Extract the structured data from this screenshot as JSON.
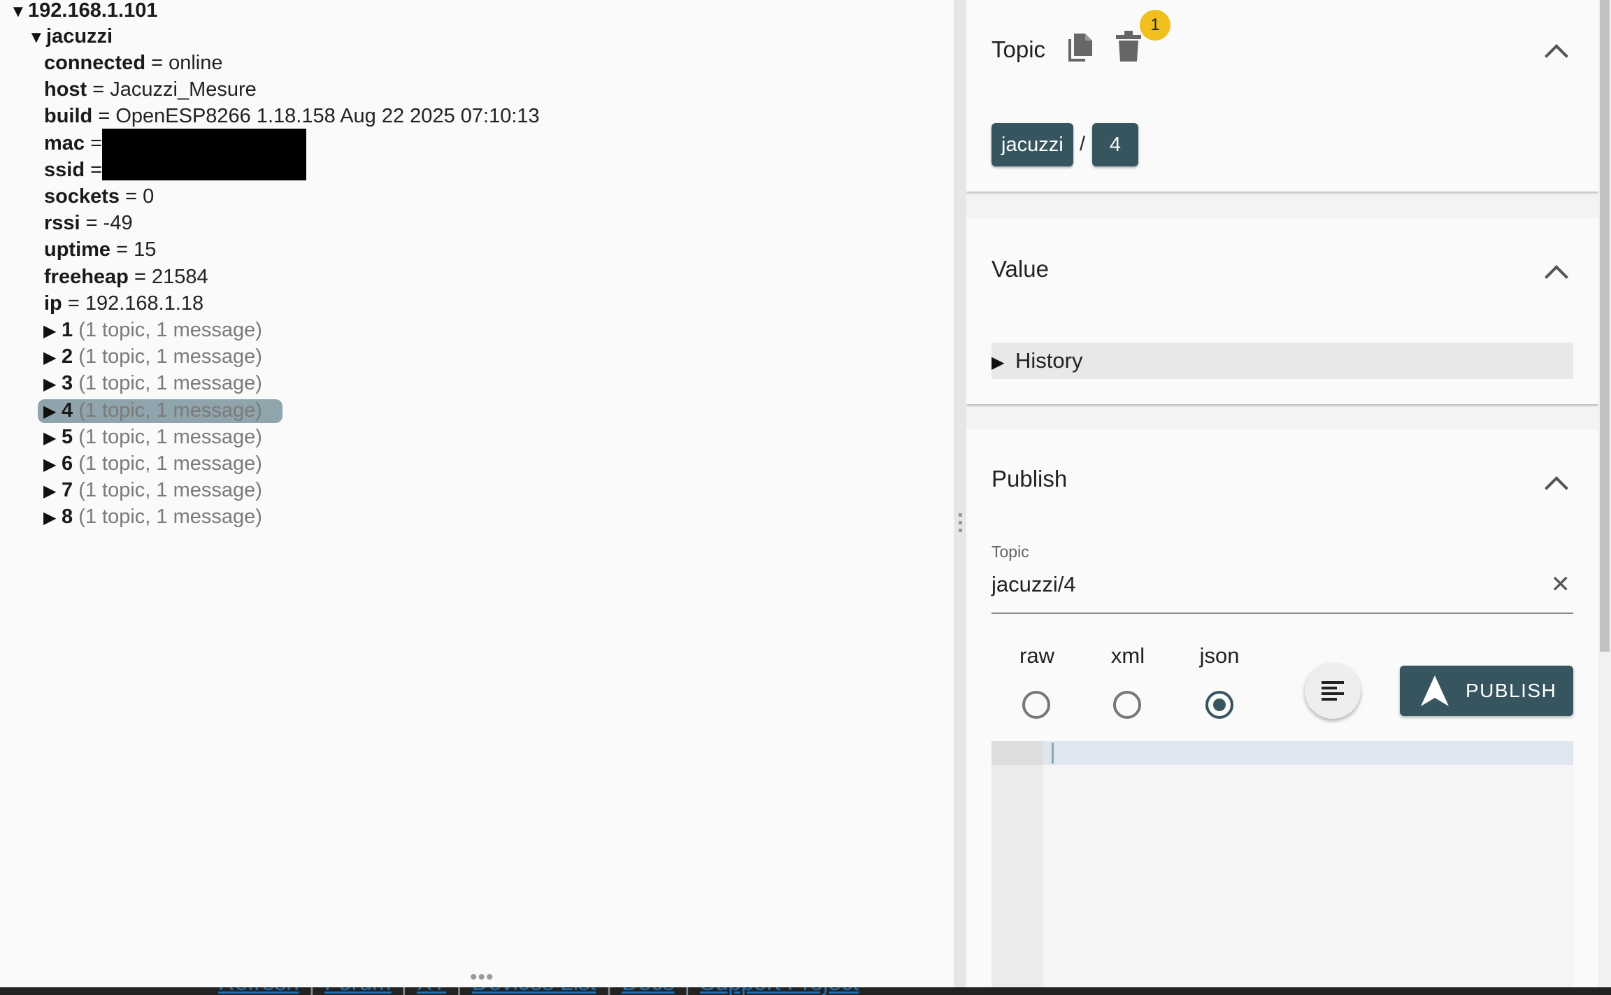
{
  "tree": {
    "root_label": "192.168.1.101",
    "folder_label": "jacuzzi",
    "props": [
      {
        "key": "connected",
        "value": "online"
      },
      {
        "key": "host",
        "value": "Jacuzzi_Mesure"
      },
      {
        "key": "build",
        "value": "OpenESP8266 1.18.158 Aug 22 2025 07:10:13"
      },
      {
        "key": "mac",
        "value": ""
      },
      {
        "key": "ssid",
        "value": ""
      },
      {
        "key": "sockets",
        "value": "0"
      },
      {
        "key": "rssi",
        "value": "-49"
      },
      {
        "key": "uptime",
        "value": "15"
      },
      {
        "key": "freeheap",
        "value": "21584"
      },
      {
        "key": "ip",
        "value": "192.168.1.18"
      }
    ],
    "equals": "=",
    "children": [
      {
        "label": "1",
        "summary": "(1 topic, 1 message)"
      },
      {
        "label": "2",
        "summary": "(1 topic, 1 message)"
      },
      {
        "label": "3",
        "summary": "(1 topic, 1 message)"
      },
      {
        "label": "4",
        "summary": "(1 topic, 1 message)",
        "selected": true
      },
      {
        "label": "5",
        "summary": "(1 topic, 1 message)"
      },
      {
        "label": "6",
        "summary": "(1 topic, 1 message)"
      },
      {
        "label": "7",
        "summary": "(1 topic, 1 message)"
      },
      {
        "label": "8",
        "summary": "(1 topic, 1 message)"
      }
    ]
  },
  "topic_panel": {
    "title": "Topic",
    "badge": "1",
    "path": [
      "jacuzzi",
      "4"
    ],
    "separator": "/"
  },
  "value_panel": {
    "title": "Value",
    "history_label": "History"
  },
  "publish_panel": {
    "title": "Publish",
    "topic_field_label": "Topic",
    "topic_value": "jacuzzi/4",
    "formats": [
      "raw",
      "xml",
      "json"
    ],
    "selected_format": "json",
    "publish_label": "PUBLISH"
  },
  "footer_links": [
    "Refresh",
    "Forum",
    "XT",
    "Devices List",
    "Docs",
    "Support Project"
  ],
  "footer_separator": "|",
  "colors": {
    "accent": "#37555f",
    "badge": "#f2c01e",
    "selection": "#90a4ae"
  }
}
